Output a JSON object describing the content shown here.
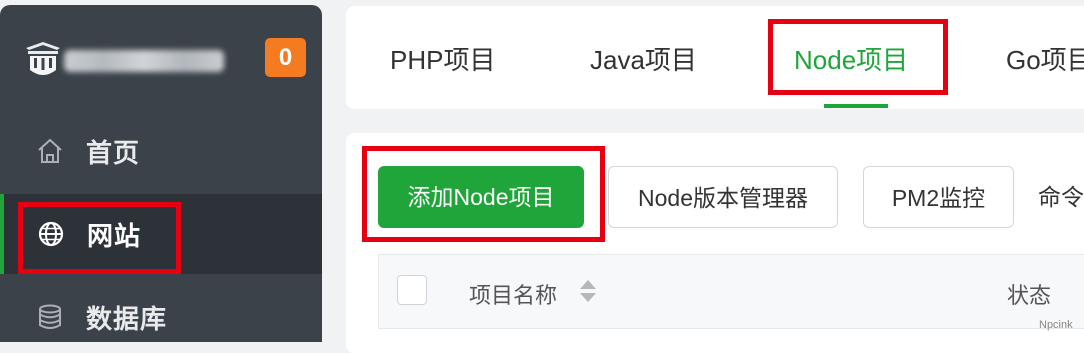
{
  "sidebar": {
    "badge": "0",
    "items": [
      {
        "label": "首页",
        "icon": "home-icon"
      },
      {
        "label": "网站",
        "icon": "globe-icon",
        "active": true
      },
      {
        "label": "数据库",
        "icon": "database-icon"
      }
    ]
  },
  "tabs": [
    {
      "label": "PHP项目"
    },
    {
      "label": "Java项目"
    },
    {
      "label": "Node项目",
      "active": true
    },
    {
      "label": "Go项目"
    }
  ],
  "toolbar": {
    "add_label": "添加Node项目",
    "version_label": "Node版本管理器",
    "pm2_label": "PM2监控",
    "cmd_label": "命令"
  },
  "table": {
    "headers": [
      "项目名称",
      "状态"
    ]
  },
  "watermark": "Npcink",
  "colors": {
    "accent": "#20a53a",
    "sidebar_bg": "#3b4249",
    "badge": "#f47b1f",
    "highlight": "#e60012"
  }
}
